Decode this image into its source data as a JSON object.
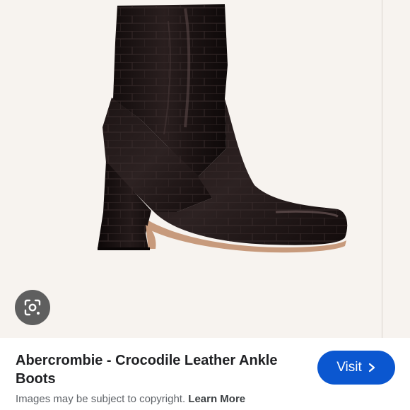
{
  "image": {
    "subject": "boot-photo",
    "background_color": "#f7f3ef",
    "boot_color": "#1a1212"
  },
  "lens": {
    "icon": "lens-camera-icon"
  },
  "result": {
    "title": "Abercrombie - Crocodile Leather Ankle Boots",
    "visit_label": "Visit",
    "visit_icon": "chevron-right-icon",
    "accent_color": "#0b57d0",
    "copyright_text": "Images may be subject to copyright.",
    "learn_more_label": "Learn More"
  }
}
